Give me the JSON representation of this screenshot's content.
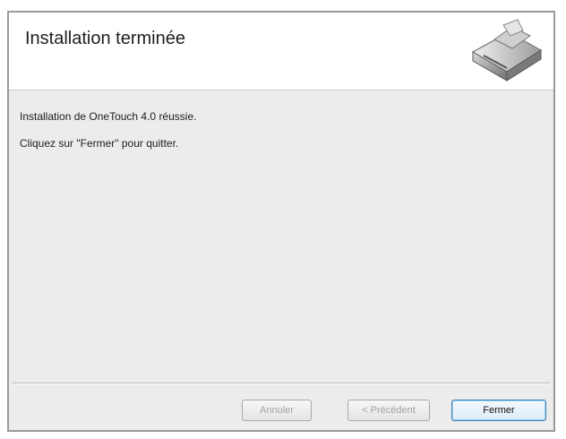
{
  "header": {
    "title": "Installation terminée",
    "icon": "scanner-icon"
  },
  "content": {
    "line1": "Installation de OneTouch 4.0 réussie.",
    "line2": "Cliquez sur \"Fermer\" pour quitter."
  },
  "buttons": {
    "cancel_label": "Annuler",
    "previous_label": "< Précédent",
    "close_label": "Fermer"
  },
  "colors": {
    "accent": "#3c7fb1",
    "panel": "#ececec",
    "disabled_text": "#a3a3a3"
  }
}
